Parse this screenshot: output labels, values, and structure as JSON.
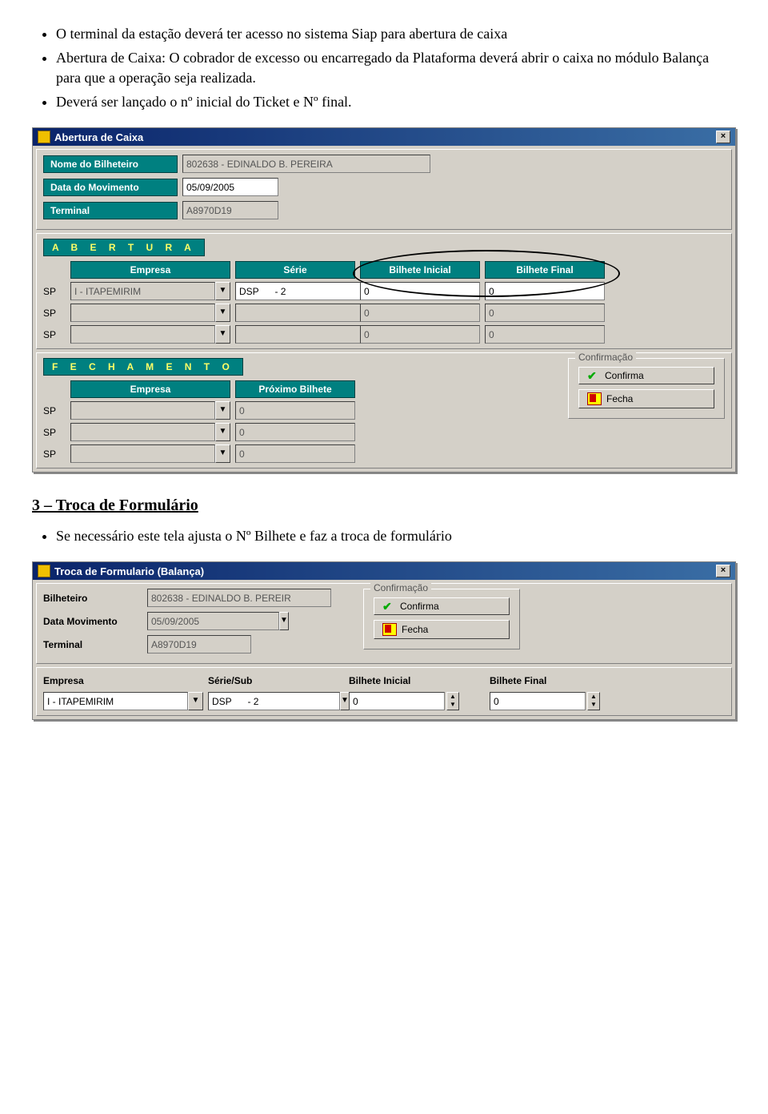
{
  "doc": {
    "bullets": [
      "O terminal da estação deverá ter acesso no sistema Siap para abertura de caixa",
      "Abertura de Caixa: O cobrador de excesso ou encarregado da Plataforma deverá abrir o caixa no módulo Balança para que a operação seja realizada.",
      "Deverá  ser lançado o nº inicial do Ticket e Nº final."
    ],
    "section3_title": "3 – Troca de Formulário",
    "section3_bullet": "Se necessário este tela ajusta o Nº Bilhete e faz a troca de formulário"
  },
  "win1": {
    "title": "Abertura de Caixa",
    "labels": {
      "nome": "Nome do Bilheteiro",
      "data": "Data do Movimento",
      "terminal": "Terminal"
    },
    "values": {
      "nome": "802638 - EDINALDO B. PEREIRA",
      "data": "05/09/2005",
      "terminal": "A8970D19"
    },
    "abertura": {
      "title": "A B E R T U R A",
      "cols": {
        "empresa": "Empresa",
        "serie": "Série",
        "bini": "Bilhete Inicial",
        "bfin": "Bilhete Final"
      },
      "rows": [
        {
          "sp": "SP",
          "empresa": "I - ITAPEMIRIM",
          "serie": "DSP      - 2",
          "bini": "0",
          "bfin": "0"
        },
        {
          "sp": "SP",
          "empresa": "",
          "serie": "",
          "bini": "0",
          "bfin": "0"
        },
        {
          "sp": "SP",
          "empresa": "",
          "serie": "",
          "bini": "0",
          "bfin": "0"
        }
      ]
    },
    "fechamento": {
      "title": "F E C H A M E N T O",
      "cols": {
        "empresa": "Empresa",
        "prox": "Próximo Bilhete"
      },
      "rows": [
        {
          "sp": "SP",
          "empresa": "",
          "prox": "0"
        },
        {
          "sp": "SP",
          "empresa": "",
          "prox": "0"
        },
        {
          "sp": "SP",
          "empresa": "",
          "prox": "0"
        }
      ],
      "groupbox": "Confirmação",
      "btn_confirma": "Confirma",
      "btn_fecha": "Fecha"
    }
  },
  "win2": {
    "title": "Troca de Formulario  (Balança)",
    "labels": {
      "bilheteiro": "Bilheteiro",
      "data": "Data Movimento",
      "terminal": "Terminal"
    },
    "values": {
      "bilheteiro": "802638 - EDINALDO B. PEREIR",
      "data": "05/09/2005",
      "terminal": "A8970D19"
    },
    "groupbox": "Confirmação",
    "btn_confirma": "Confirma",
    "btn_fecha": "Fecha",
    "cols": {
      "empresa": "Empresa",
      "serie": "Série/Sub",
      "bini": "Bilhete Inicial",
      "bfin": "Bilhete Final"
    },
    "row": {
      "empresa": "I - ITAPEMIRIM",
      "serie": "DSP      - 2",
      "bini": "0",
      "bfin": "0"
    }
  }
}
